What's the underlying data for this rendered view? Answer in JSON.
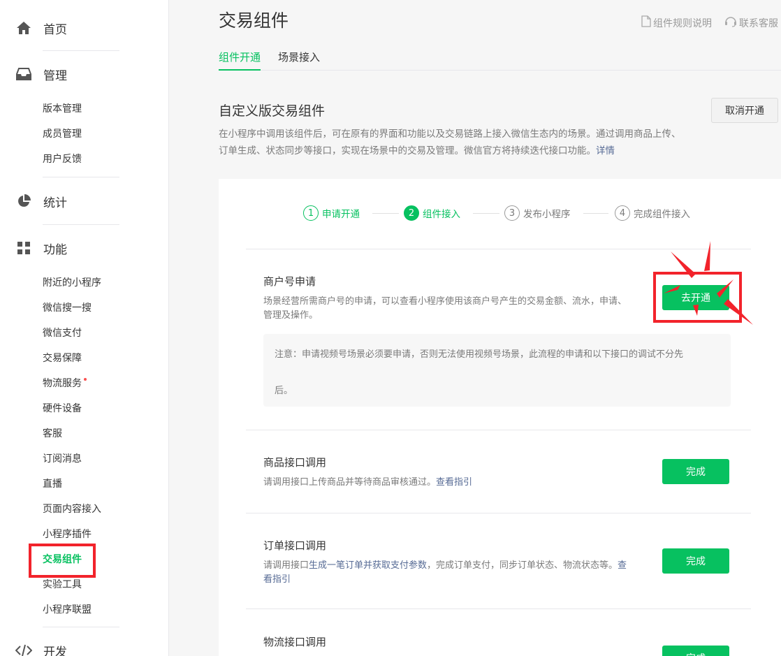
{
  "sidebar": {
    "groups": [
      {
        "label": "首页",
        "icon": "home-icon"
      },
      {
        "label": "管理",
        "icon": "inbox-icon",
        "items": [
          "版本管理",
          "成员管理",
          "用户反馈"
        ]
      },
      {
        "label": "统计",
        "icon": "pie-chart-icon"
      },
      {
        "label": "功能",
        "icon": "grid-icon",
        "items": [
          "附近的小程序",
          "微信搜一搜",
          "微信支付",
          "交易保障",
          "物流服务",
          "硬件设备",
          "客服",
          "订阅消息",
          "直播",
          "页面内容接入",
          "小程序插件",
          "交易组件",
          "实验工具",
          "小程序联盟"
        ]
      },
      {
        "label": "开发",
        "icon": "code-icon"
      }
    ],
    "active_item": "交易组件"
  },
  "header": {
    "title": "交易组件",
    "links": {
      "rules": "组件规则说明",
      "service": "联系客服"
    }
  },
  "tabs": [
    {
      "label": "组件开通",
      "active": true
    },
    {
      "label": "场景接入",
      "active": false
    }
  ],
  "section": {
    "title": "自定义版交易组件",
    "cancel_label": "取消开通",
    "desc": "在小程序中调用该组件后，可在原有的界面和功能以及交易链路上接入微信生态内的场景。通过调用商品上传、订单生成、状态同步等接口，实现在场景中的交易及管理。微信官方将持续迭代接口功能。",
    "desc_link": "详情"
  },
  "steps": [
    {
      "num": "1",
      "label": "申请开通",
      "state": "done"
    },
    {
      "num": "2",
      "label": "组件接入",
      "state": "current"
    },
    {
      "num": "3",
      "label": "发布小程序",
      "state": "todo"
    },
    {
      "num": "4",
      "label": "完成组件接入",
      "state": "todo"
    }
  ],
  "rows": {
    "merchant": {
      "title": "商户号申请",
      "desc_line1": "场景经营所需商户号的申请，可以查看小程序使用该商户号产生的交易金额、流水，申请、",
      "desc_line2": "管理及操作。",
      "button": "去开通",
      "notice_line1": "注意：申请视频号场景必须要申请，否则无法使用视频号场景，此流程的申请和以下接口的调试不分先",
      "notice_line2": "后。"
    },
    "product": {
      "title": "商品接口调用",
      "desc": "请调用接口上传商品并等待商品审核通过。",
      "link": "查看指引",
      "button": "完成"
    },
    "order": {
      "title": "订单接口调用",
      "desc_pre": "请调用接口",
      "desc_link": "生成一笔订单并获取支付参数",
      "desc_post": "，完成订单支付，同步订单状态、物流状态等。",
      "link_part1": "查",
      "link_part2": "看指引",
      "button": "完成"
    },
    "logistics": {
      "title": "物流接口调用",
      "button": "完成"
    }
  },
  "colors": {
    "brand": "#07c160",
    "link": "#576b95",
    "highlight": "#f2232b"
  }
}
